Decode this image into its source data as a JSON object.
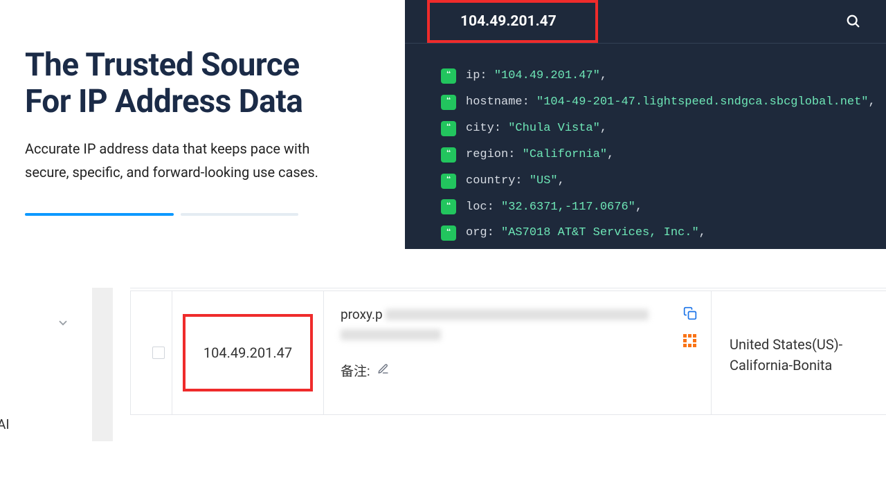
{
  "hero": {
    "title_l1": "The Trusted Source",
    "title_l2": "For IP Address Data",
    "subtitle": "Accurate IP address data that keeps pace with secure, specific, and forward-looking use cases."
  },
  "code_panel": {
    "search_ip": "104.49.201.47",
    "rows": [
      {
        "key": "ip",
        "value": "\"104.49.201.47\""
      },
      {
        "key": "hostname",
        "value": "\"104-49-201-47.lightspeed.sndgca.sbcglobal.net\""
      },
      {
        "key": "city",
        "value": "\"Chula Vista\""
      },
      {
        "key": "region",
        "value": "\"California\""
      },
      {
        "key": "country",
        "value": "\"US\""
      },
      {
        "key": "loc",
        "value": "\"32.6371,-117.0676\""
      },
      {
        "key": "org",
        "value": "\"AS7018 AT&T Services, Inc.\""
      }
    ]
  },
  "table_row": {
    "ip": "104.49.201.47",
    "proxy_prefix": "proxy.p",
    "note_label": "备注:",
    "location": "United States(US)-California-Bonita"
  },
  "misc": {
    "ai_fragment": "AI"
  }
}
